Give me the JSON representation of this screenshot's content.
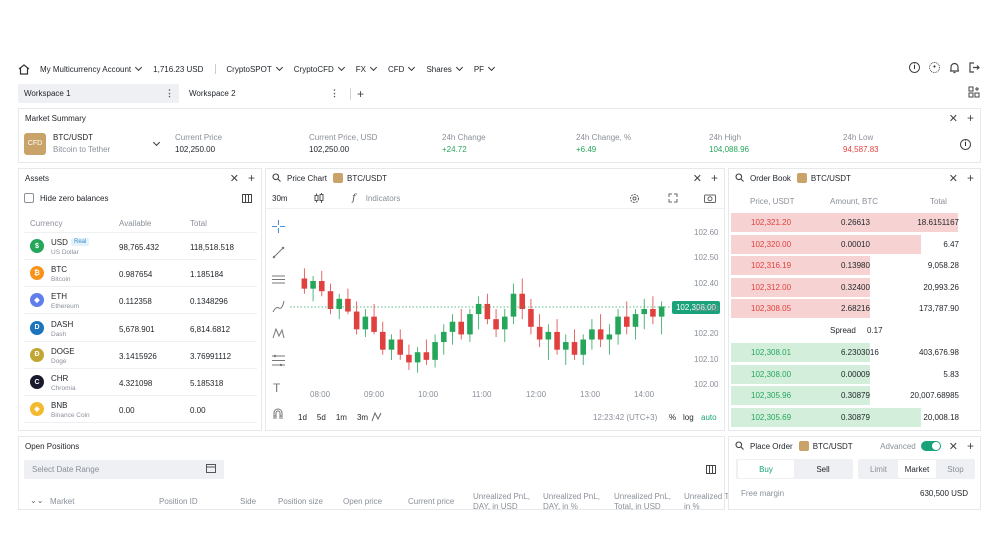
{
  "topbar": {
    "account": "My Multicurrency Account",
    "balance": "1,716.23 USD",
    "menus": [
      "CryptoSPOT",
      "CryptoCFD",
      "FX",
      "CFD",
      "Shares",
      "PF"
    ]
  },
  "tabs": [
    {
      "label": "Workspace 1"
    },
    {
      "label": "Workspace 2"
    }
  ],
  "market_summary": {
    "title": "Market Summary",
    "pair": "BTC/USDT",
    "pair_desc": "Bitcoin to Tether",
    "pair_icon": "CFD",
    "cells": [
      {
        "label": "Current Price",
        "value": "102,250.00",
        "color": "#1f2328"
      },
      {
        "label": "Current Price, USD",
        "value": "102,250.00",
        "color": "#1f2328"
      },
      {
        "label": "24h Change",
        "value": "+24.72",
        "color": "#26a65b"
      },
      {
        "label": "24h Change, %",
        "value": "+6.49",
        "color": "#26a65b"
      },
      {
        "label": "24h High",
        "value": "104,088.96",
        "color": "#26a65b"
      },
      {
        "label": "24h Low",
        "value": "94,587.83",
        "color": "#e0413f"
      }
    ]
  },
  "assets": {
    "title": "Assets",
    "hide_zero": "Hide zero balances",
    "headers": [
      "Currency",
      "Available",
      "Total"
    ],
    "rows": [
      {
        "code": "USD",
        "name": "US Dollar",
        "badge": "Real",
        "available": "98,765.432",
        "total": "118,518.518",
        "color": "#26a65b",
        "glyph": "$"
      },
      {
        "code": "BTC",
        "name": "Bitcoin",
        "badge": "",
        "available": "0.987654",
        "total": "1.185184",
        "color": "#f7931a",
        "glyph": "₿"
      },
      {
        "code": "ETH",
        "name": "Ethereum",
        "badge": "",
        "available": "0.112358",
        "total": "0.1348296",
        "color": "#627eea",
        "glyph": "◆"
      },
      {
        "code": "DASH",
        "name": "Dash",
        "badge": "",
        "available": "5,678.901",
        "total": "6,814.6812",
        "color": "#1c75bc",
        "glyph": "D"
      },
      {
        "code": "DOGE",
        "name": "Doge",
        "badge": "",
        "available": "3.1415926",
        "total": "3.76991112",
        "color": "#c2a633",
        "glyph": "Ð"
      },
      {
        "code": "CHR",
        "name": "Chromia",
        "badge": "",
        "available": "4.321098",
        "total": "5.185318",
        "color": "#1a1a2e",
        "glyph": "C"
      },
      {
        "code": "BNB",
        "name": "Binance Coin",
        "badge": "",
        "available": "0.00",
        "total": "0.00",
        "color": "#f3ba2f",
        "glyph": "◈"
      }
    ]
  },
  "price_chart": {
    "title": "Price Chart",
    "pair": "BTC/USDT",
    "interval": "30m",
    "indicators": "Indicators",
    "current_price_tag": "102,308.00",
    "ranges": [
      "1d",
      "5d",
      "1m",
      "3m"
    ],
    "timestamp": "12:23:42 (UTC+3)",
    "pct": "%",
    "log": "log",
    "auto": "auto"
  },
  "chart_data": {
    "type": "candlestick",
    "xlabels": [
      "08:00",
      "09:00",
      "10:00",
      "11:00",
      "12:00",
      "13:00",
      "14:00"
    ],
    "ylabels": [
      "102.60",
      "102.50",
      "102.40",
      "102.30",
      "102.20",
      "102.10",
      "102.00"
    ],
    "ylim": [
      101.95,
      102.65
    ],
    "last_price": 102.308,
    "up_color": "#26a65b",
    "down_color": "#e0413f",
    "series": [
      [
        102.42,
        102.46,
        102.36,
        102.38
      ],
      [
        102.38,
        102.43,
        102.33,
        102.41
      ],
      [
        102.41,
        102.45,
        102.35,
        102.37
      ],
      [
        102.37,
        102.4,
        102.28,
        102.3
      ],
      [
        102.3,
        102.36,
        102.26,
        102.34
      ],
      [
        102.34,
        102.38,
        102.28,
        102.29
      ],
      [
        102.29,
        102.33,
        102.2,
        102.22
      ],
      [
        102.22,
        102.3,
        102.19,
        102.27
      ],
      [
        102.27,
        102.32,
        102.2,
        102.21
      ],
      [
        102.21,
        102.25,
        102.12,
        102.14
      ],
      [
        102.14,
        102.2,
        102.1,
        102.18
      ],
      [
        102.18,
        102.22,
        102.1,
        102.12
      ],
      [
        102.12,
        102.16,
        102.06,
        102.09
      ],
      [
        102.09,
        102.15,
        102.05,
        102.13
      ],
      [
        102.13,
        102.18,
        102.08,
        102.1
      ],
      [
        102.1,
        102.2,
        102.07,
        102.17
      ],
      [
        102.17,
        102.24,
        102.12,
        102.21
      ],
      [
        102.21,
        102.28,
        102.16,
        102.25
      ],
      [
        102.25,
        102.3,
        102.18,
        102.2
      ],
      [
        102.2,
        102.3,
        102.17,
        102.28
      ],
      [
        102.28,
        102.35,
        102.22,
        102.32
      ],
      [
        102.32,
        102.36,
        102.24,
        102.26
      ],
      [
        102.26,
        102.3,
        102.19,
        102.22
      ],
      [
        102.22,
        102.3,
        102.17,
        102.27
      ],
      [
        102.27,
        102.4,
        102.24,
        102.36
      ],
      [
        102.36,
        102.42,
        102.26,
        102.3
      ],
      [
        102.3,
        102.34,
        102.2,
        102.23
      ],
      [
        102.23,
        102.28,
        102.15,
        102.18
      ],
      [
        102.18,
        102.24,
        102.1,
        102.21
      ],
      [
        102.21,
        102.26,
        102.12,
        102.14
      ],
      [
        102.14,
        102.2,
        102.08,
        102.17
      ],
      [
        102.17,
        102.22,
        102.1,
        102.12
      ],
      [
        102.12,
        102.2,
        102.08,
        102.18
      ],
      [
        102.18,
        102.26,
        102.14,
        102.22
      ],
      [
        102.22,
        102.28,
        102.15,
        102.18
      ],
      [
        102.18,
        102.24,
        102.12,
        102.2
      ],
      [
        102.2,
        102.3,
        102.16,
        102.27
      ],
      [
        102.27,
        102.33,
        102.2,
        102.23
      ],
      [
        102.23,
        102.3,
        102.18,
        102.28
      ],
      [
        102.28,
        102.34,
        102.22,
        102.3
      ],
      [
        102.3,
        102.35,
        102.24,
        102.27
      ],
      [
        102.27,
        102.33,
        102.2,
        102.31
      ]
    ]
  },
  "order_book": {
    "title": "Order Book",
    "pair": "BTC/USDT",
    "headers": [
      "Price, USDT",
      "Amount, BTC",
      "Total"
    ],
    "asks": [
      {
        "price": "102,321.20",
        "amount": "0.26613",
        "total": "18.6151167",
        "depth": 0.98
      },
      {
        "price": "102,320.00",
        "amount": "0.00010",
        "total": "6.47",
        "depth": 0.82
      },
      {
        "price": "102,316.19",
        "amount": "0.13980",
        "total": "9,058.28",
        "depth": 0.6
      },
      {
        "price": "102,312.00",
        "amount": "0.32400",
        "total": "20,993.26",
        "depth": 0.6
      },
      {
        "price": "102,308.05",
        "amount": "2.68216",
        "total": "173,787.90",
        "depth": 0.6
      }
    ],
    "spread_label": "Spread",
    "spread_value": "0.17",
    "bids": [
      {
        "price": "102,308.01",
        "amount": "6.2303016",
        "total": "403,676.98",
        "depth": 0.6
      },
      {
        "price": "102,308.00",
        "amount": "0.00009",
        "total": "5.83",
        "depth": 0.6
      },
      {
        "price": "102,305.96",
        "amount": "0.30879",
        "total": "20,007.68985",
        "depth": 0.6
      },
      {
        "price": "102,305.69",
        "amount": "0.30879",
        "total": "20,008.18",
        "depth": 0.82
      }
    ]
  },
  "open_positions": {
    "title": "Open Positions",
    "date_range": "Select Date Range",
    "headers": [
      "Market",
      "Position ID",
      "Side",
      "Position size",
      "Open price",
      "Current price",
      "Unrealized PnL, DAY, in USD",
      "Unrealized PnL, DAY, in %",
      "Unrealized PnL, Total, in USD",
      "Unrealized Total, in %"
    ]
  },
  "place_order": {
    "title": "Place Order",
    "pair": "BTC/USDT",
    "advanced": "Advanced",
    "buy": "Buy",
    "sell": "Sell",
    "types": [
      "Limit",
      "Market",
      "Stop"
    ],
    "free_margin_label": "Free margin",
    "free_margin_value": "630,500 USD"
  },
  "colors": {
    "accent": "#1aa37a",
    "ask_bg": "#f6d3d2",
    "bid_bg": "#d3efdc"
  }
}
